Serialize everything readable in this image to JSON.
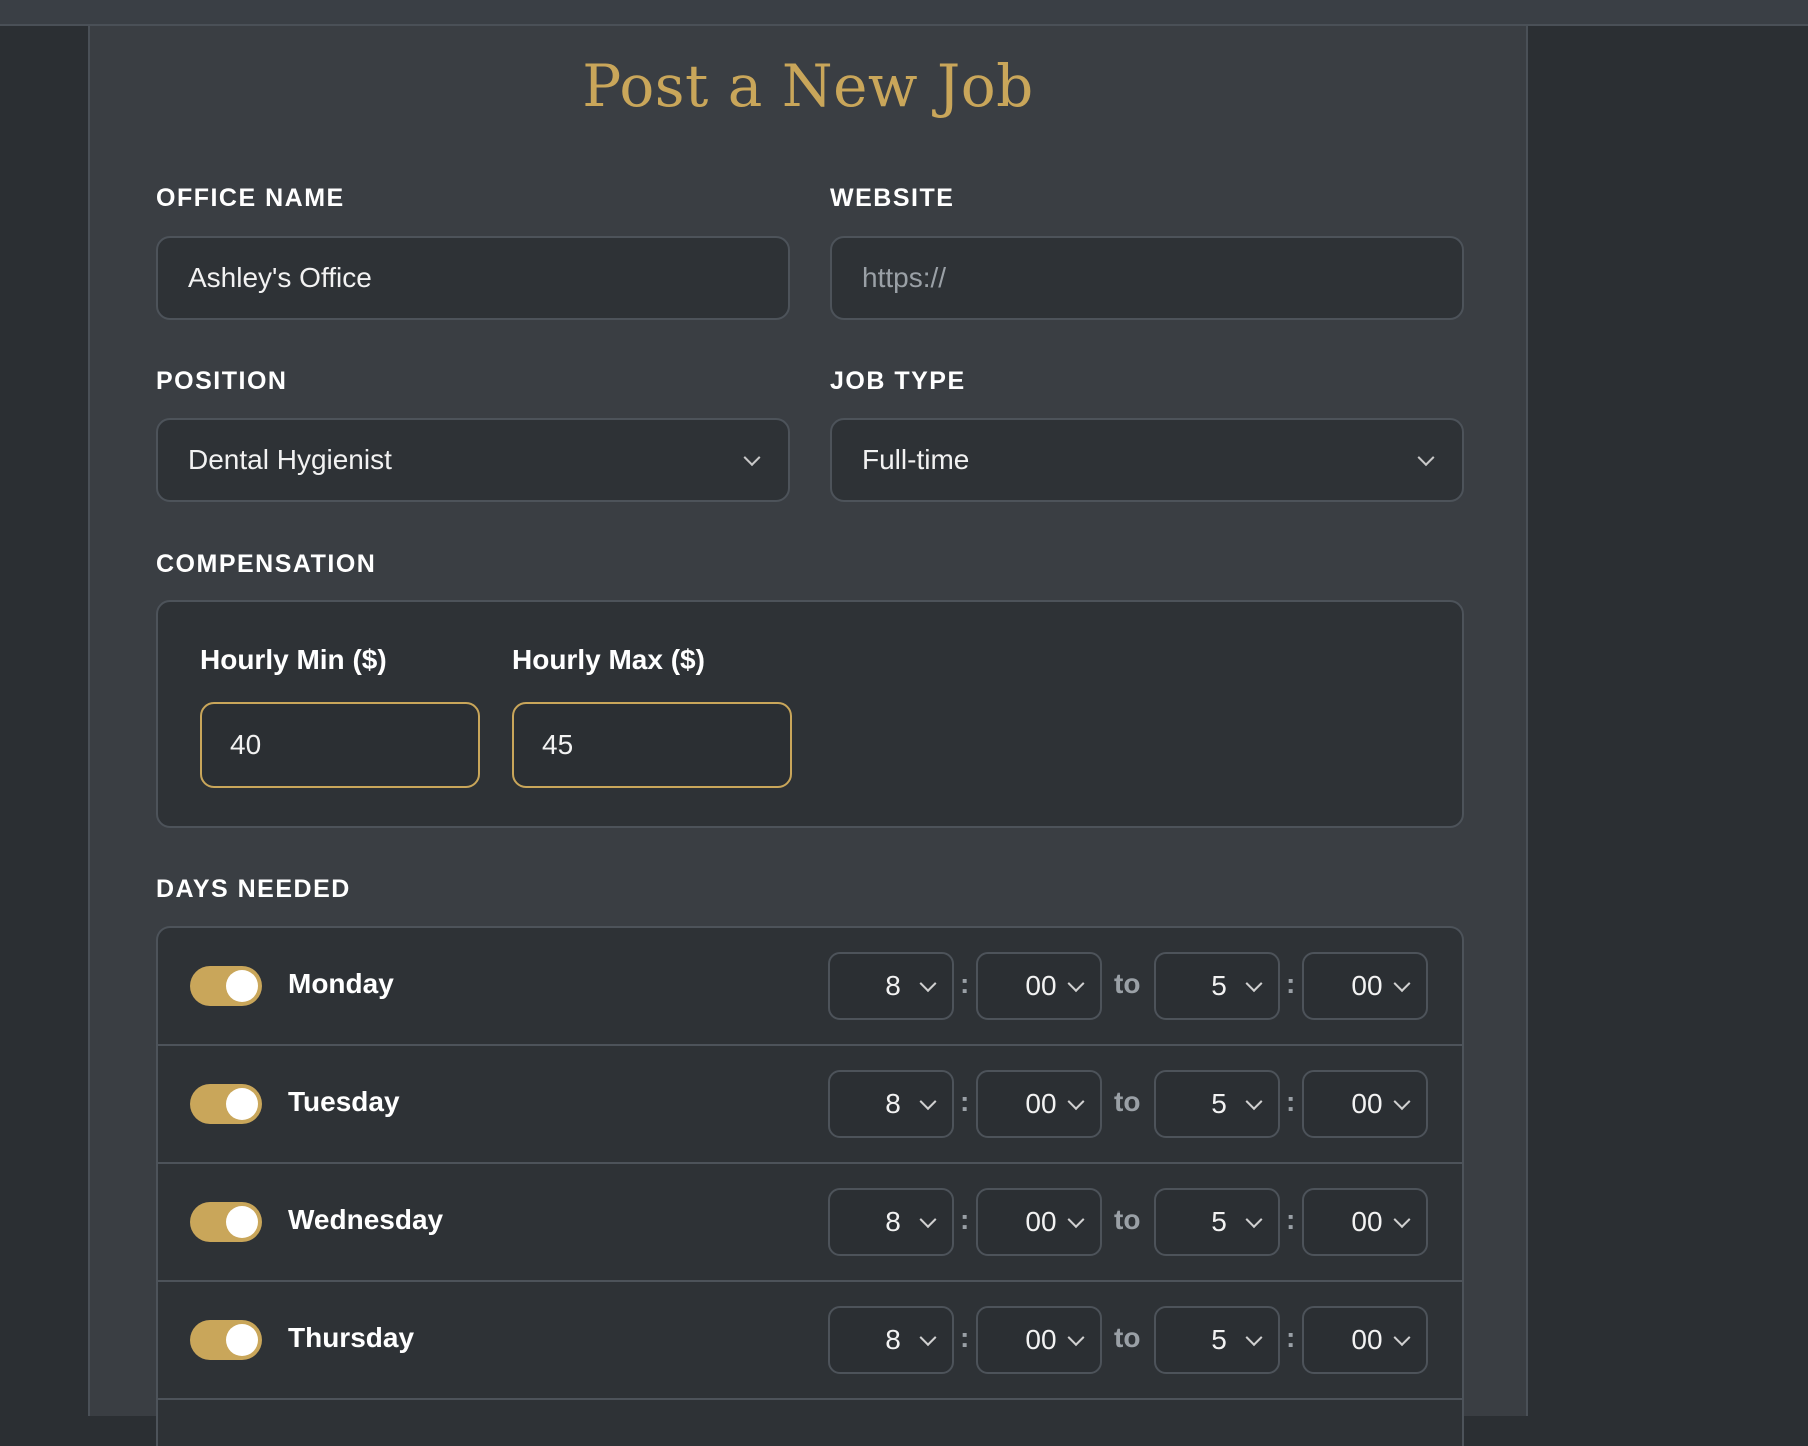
{
  "page": {
    "title": "Post a New Job"
  },
  "form": {
    "office_name": {
      "label": "OFFICE NAME",
      "value": "Ashley's Office"
    },
    "website": {
      "label": "WEBSITE",
      "placeholder": "https://"
    },
    "position": {
      "label": "POSITION",
      "value": "Dental Hygienist"
    },
    "job_type": {
      "label": "JOB TYPE",
      "value": "Full-time"
    },
    "compensation": {
      "label": "COMPENSATION",
      "min": {
        "label": "Hourly Min ($)",
        "value": "40"
      },
      "max": {
        "label": "Hourly Max ($)",
        "value": "45"
      }
    },
    "days": {
      "label": "DAYS NEEDED",
      "to_label": "to",
      "colon": ":",
      "items": [
        {
          "name": "Monday",
          "enabled": true,
          "start_hour": "8",
          "start_min": "00",
          "end_hour": "5",
          "end_min": "00"
        },
        {
          "name": "Tuesday",
          "enabled": true,
          "start_hour": "8",
          "start_min": "00",
          "end_hour": "5",
          "end_min": "00"
        },
        {
          "name": "Wednesday",
          "enabled": true,
          "start_hour": "8",
          "start_min": "00",
          "end_hour": "5",
          "end_min": "00"
        },
        {
          "name": "Thursday",
          "enabled": true,
          "start_hour": "8",
          "start_min": "00",
          "end_hour": "5",
          "end_min": "00"
        }
      ]
    }
  },
  "colors": {
    "accent": "#c9a65a",
    "background": "#2b2f33",
    "panel": "#3a3e43",
    "field": "#2e3236"
  }
}
